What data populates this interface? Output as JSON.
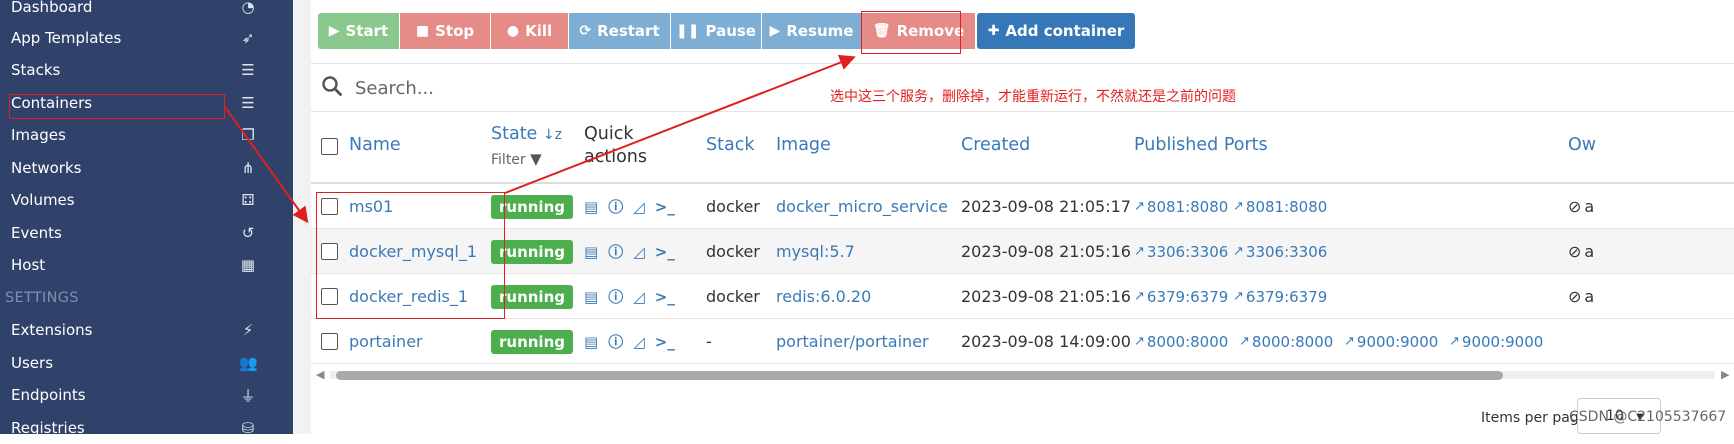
{
  "sidebar": {
    "items": [
      {
        "label": "Dashboard",
        "icon": "dashboard-icon",
        "glyph": "◔"
      },
      {
        "label": "App Templates",
        "icon": "rocket-icon",
        "glyph": "➶"
      },
      {
        "label": "Stacks",
        "icon": "list-icon",
        "glyph": "☰"
      },
      {
        "label": "Containers",
        "icon": "server-icon",
        "glyph": "☰"
      },
      {
        "label": "Images",
        "icon": "clone-icon",
        "glyph": "❐"
      },
      {
        "label": "Networks",
        "icon": "sitemap-icon",
        "glyph": "⋔"
      },
      {
        "label": "Volumes",
        "icon": "cubes-icon",
        "glyph": "⚃"
      },
      {
        "label": "Events",
        "icon": "history-icon",
        "glyph": "↺"
      },
      {
        "label": "Host",
        "icon": "th-icon",
        "glyph": "▦"
      }
    ],
    "settings_label": "SETTINGS",
    "settings_items": [
      {
        "label": "Extensions",
        "icon": "bolt-icon",
        "glyph": "⚡"
      },
      {
        "label": "Users",
        "icon": "users-icon",
        "glyph": "👥"
      },
      {
        "label": "Endpoints",
        "icon": "plug-icon",
        "glyph": "⏚"
      },
      {
        "label": "Registries",
        "icon": "database-icon",
        "glyph": "⛁"
      }
    ]
  },
  "toolbar": {
    "start_label": "Start",
    "stop_label": "Stop",
    "kill_label": "Kill",
    "restart_label": "Restart",
    "pause_label": "Pause",
    "resume_label": "Resume",
    "remove_label": "Remove",
    "add_label": "Add container"
  },
  "search": {
    "placeholder": "Search..."
  },
  "annotation": {
    "text": "选中这三个服务，删除掉，才能重新运行，不然就还是之前的问题"
  },
  "table": {
    "headers": {
      "name": "Name",
      "state": "State",
      "state_sort": "↓z",
      "filter": "Filter",
      "quick_actions_1": "Quick",
      "quick_actions_2": "actions",
      "stack": "Stack",
      "image": "Image",
      "created": "Created",
      "published_ports": "Published Ports",
      "ownership": "Ow"
    },
    "rows": [
      {
        "name": "ms01",
        "state": "running",
        "stack": "docker",
        "image": "docker_micro_service",
        "created": "2023-09-08 21:05:17",
        "ports": [
          "8081:8080",
          "8081:8080"
        ],
        "owner": "a"
      },
      {
        "name": "docker_mysql_1",
        "state": "running",
        "stack": "docker",
        "image": "mysql:5.7",
        "created": "2023-09-08 21:05:16",
        "ports": [
          "3306:3306",
          "3306:3306"
        ],
        "owner": "a"
      },
      {
        "name": "docker_redis_1",
        "state": "running",
        "stack": "docker",
        "image": "redis:6.0.20",
        "created": "2023-09-08 21:05:16",
        "ports": [
          "6379:6379",
          "6379:6379"
        ],
        "owner": "a"
      },
      {
        "name": "portainer",
        "state": "running",
        "stack": "-",
        "image": "portainer/portainer",
        "created": "2023-09-08 14:09:00",
        "ports": [
          "8000:8000",
          "8000:8000",
          "9000:9000",
          "9000:9000"
        ],
        "owner": ""
      }
    ]
  },
  "footer": {
    "items_per_page": "Items per page",
    "per_page_value": "10",
    "watermark": "CSDN @C2105537667"
  },
  "colors": {
    "sidebar": "#30426a",
    "link": "#3a7ab8",
    "running": "#4cae4c",
    "annotation": "#e02020"
  }
}
